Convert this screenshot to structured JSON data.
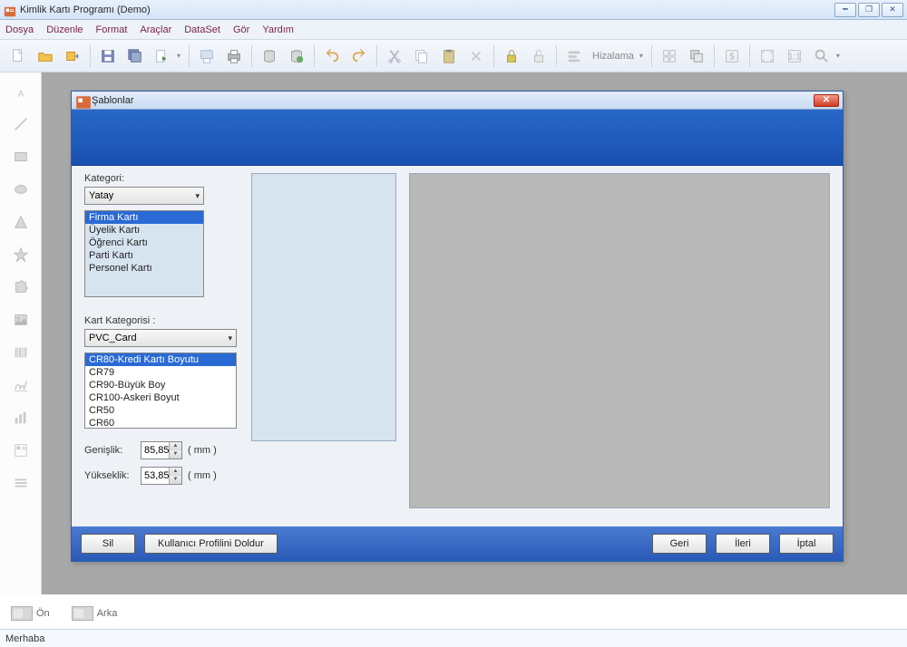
{
  "app": {
    "title": "Kimlik Kartı Programı (Demo)"
  },
  "menu": {
    "dosya": "Dosya",
    "duzenle": "Düzenle",
    "format": "Format",
    "araclar": "Araçlar",
    "dataset": "DataSet",
    "gor": "Gör",
    "yardim": "Yardım"
  },
  "toolbar": {
    "hizalama": "Hizalama"
  },
  "dialog": {
    "title": "Şablonlar",
    "kategori_label": "Kategori:",
    "kategori_value": "Yatay",
    "kategori_items": [
      "Firma Kartı",
      "Üyelik Kartı",
      "Öğrenci Kartı",
      "Parti Kartı",
      "Personel Kartı"
    ],
    "kart_kategori_label": "Kart Kategorisi :",
    "kart_kategori_value": "PVC_Card",
    "kart_sizes": [
      "CR80-Kredi Kartı Boyutu",
      "CR79",
      "CR90-Büyük Boy",
      "CR100-Askeri Boyut",
      "CR50",
      "CR60"
    ],
    "genislik_label": "Genişlik:",
    "genislik_value": "85,85",
    "yukseklik_label": "Yükseklik:",
    "yukseklik_value": "53,85",
    "unit": "( mm )",
    "btn_sil": "Sil",
    "btn_profil": "Kullanıcı Profilini Doldur",
    "btn_geri": "Geri",
    "btn_ileri": "İleri",
    "btn_iptal": "İptal"
  },
  "tabs": {
    "on": "Ön",
    "arka": "Arka"
  },
  "status": {
    "msg": "Merhaba"
  }
}
